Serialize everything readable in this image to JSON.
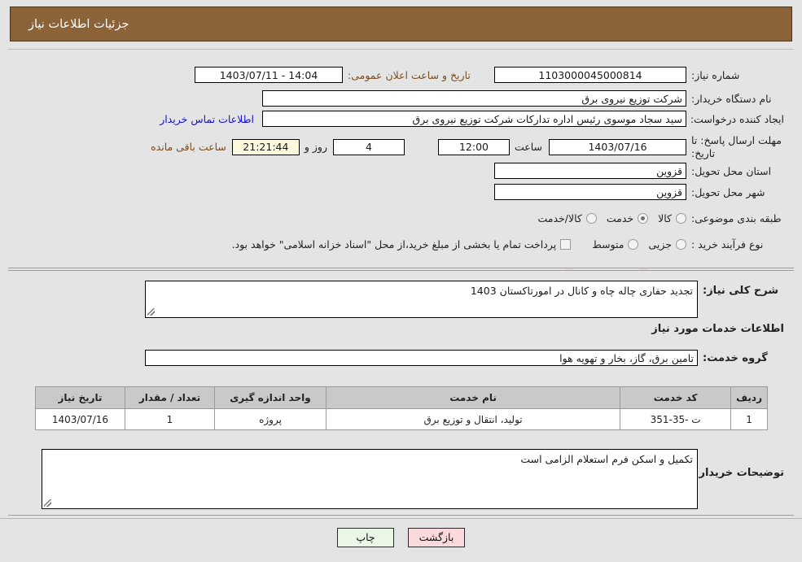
{
  "header": {
    "title": "جزئیات اطلاعات نیاز"
  },
  "watermark": {
    "text": "AnaTender.net"
  },
  "form": {
    "need_number_label": "شماره نیاز:",
    "need_number_value": "1103000045000814",
    "announce_label": "تاریخ و ساعت اعلان عمومی:",
    "announce_value": "14:04 - 1403/07/11",
    "buyer_org_label": "نام دستگاه خریدار:",
    "buyer_org_value": "شرکت توزیع نیروی برق",
    "creator_label": "ایجاد کننده درخواست:",
    "creator_value": "سید سجاد موسوی رئیس اداره تدارکات شرکت توزیع نیروی برق",
    "contact_link": "اطلاعات تماس خریدار",
    "deadline_label": "مهلت ارسال پاسخ: تا تاریخ:",
    "deadline_date": "1403/07/16",
    "time_label": "ساعت",
    "deadline_time": "12:00",
    "days_value": "4",
    "days_label": "روز و",
    "countdown_value": "21:21:44",
    "remaining_label": "ساعت باقی مانده",
    "province_label": "استان محل تحویل:",
    "province_value": "قزوین",
    "city_label": "شهر محل تحویل:",
    "city_value": "قزوین",
    "category_label": "طبقه بندی موضوعی:",
    "category_options": [
      {
        "label": "کالا",
        "selected": false
      },
      {
        "label": "خدمت",
        "selected": true
      },
      {
        "label": "کالا/خدمت",
        "selected": false
      }
    ],
    "process_label": "نوع فرآیند خرید :",
    "process_options": [
      {
        "label": "جزیی",
        "selected": false
      },
      {
        "label": "متوسط",
        "selected": false
      }
    ],
    "treasury_checkbox_text": "پرداخت تمام یا بخشی از مبلغ خرید،از محل \"اسناد خزانه اسلامی\" خواهد بود.",
    "treasury_checked": false
  },
  "description": {
    "label": "شرح کلی نیاز:",
    "value": "تجدید حفاری چاله چاه و کانال در امورتاکستان 1403"
  },
  "services": {
    "section_title": "اطلاعات خدمات مورد نیاز",
    "group_label": "گروه خدمت:",
    "group_value": "تامین برق، گاز، بخار و تهویه هوا",
    "columns": [
      "ردیف",
      "کد خدمت",
      "نام خدمت",
      "واحد اندازه گیری",
      "تعداد / مقدار",
      "تاریخ نیاز"
    ],
    "rows": [
      {
        "index": "1",
        "code": "ت -35-351",
        "name": "تولید، انتقال و توزیع برق",
        "unit": "پروژه",
        "quantity": "1",
        "need_date": "1403/07/16"
      }
    ]
  },
  "buyer_notes": {
    "label": "توضیحات خریدار:",
    "value": "تکمیل و اسکن فرم استعلام الزامی است"
  },
  "footer": {
    "back_label": "بازگشت",
    "print_label": "چاپ"
  }
}
